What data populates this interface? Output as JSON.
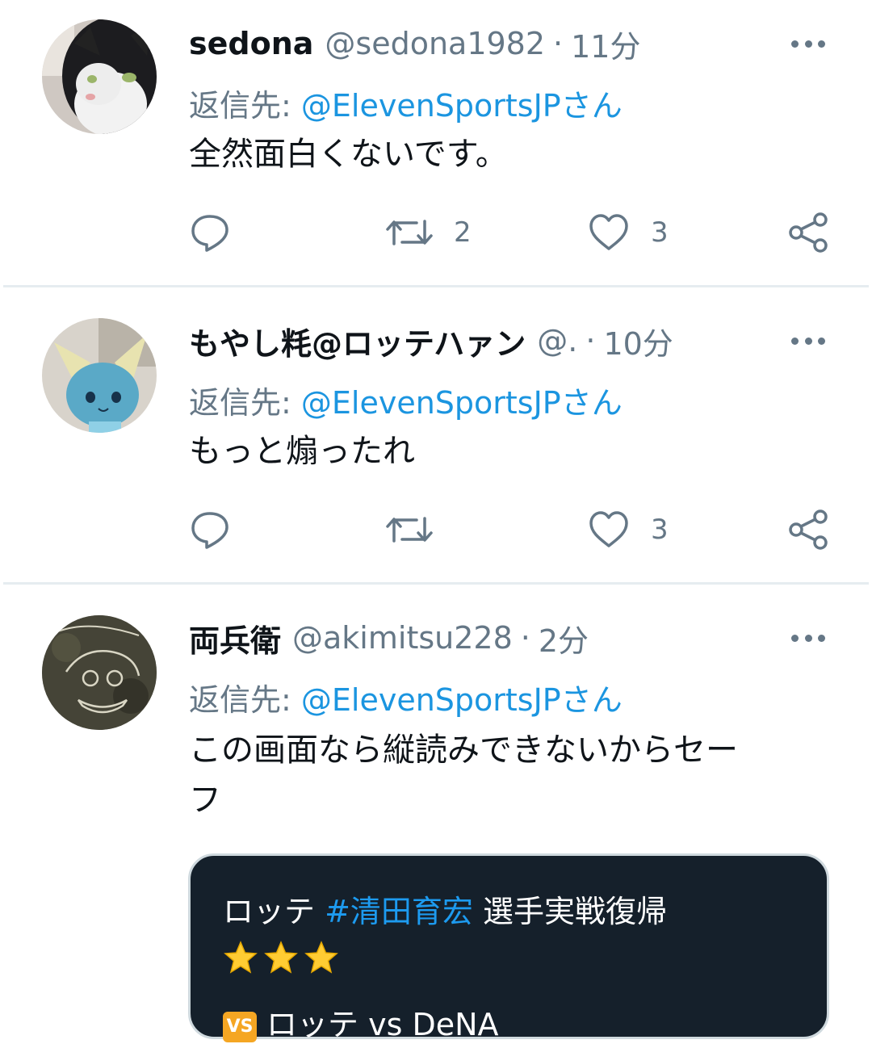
{
  "tweets": [
    {
      "name": "sedona",
      "handle": "@sedona1982",
      "dot": "·",
      "time": "11分",
      "reply_prefix": "返信先: ",
      "reply_mention": "@ElevenSportsJPさん",
      "text": "全然面白くないです。",
      "retweets": "2",
      "likes": "3",
      "avatar": "cat-photo"
    },
    {
      "name": "もやし粍@ロッテハァン",
      "handle": "@.",
      "dot": "·",
      "time": "10分",
      "reply_prefix": "返信先: ",
      "reply_mention": "@ElevenSportsJPさん",
      "text": "もっと煽ったれ",
      "retweets": "",
      "likes": "3",
      "avatar": "plush-toy-photo"
    },
    {
      "name": "両兵衛",
      "handle": "@akimitsu228",
      "dot": "·",
      "time": "2分",
      "reply_prefix": "返信先: ",
      "reply_mention": "@ElevenSportsJPさん",
      "text_line1": "この画面なら縦読みできないからセー",
      "text_line2": "フ",
      "avatar": "sketch-photo"
    }
  ],
  "card": {
    "line1_prefix": "ロッテ ",
    "line1_hashtag": "#清田育宏",
    "line1_suffix": " 選手実戦復帰",
    "stars": "⭐⭐⭐",
    "vs_badge": "VS",
    "line3": "ロッテ vs DeNA"
  },
  "colors": {
    "secondary_text": "#657786",
    "mention_blue": "#1b95e0",
    "card_bg": "#15202b",
    "icon_gray": "#657786"
  }
}
